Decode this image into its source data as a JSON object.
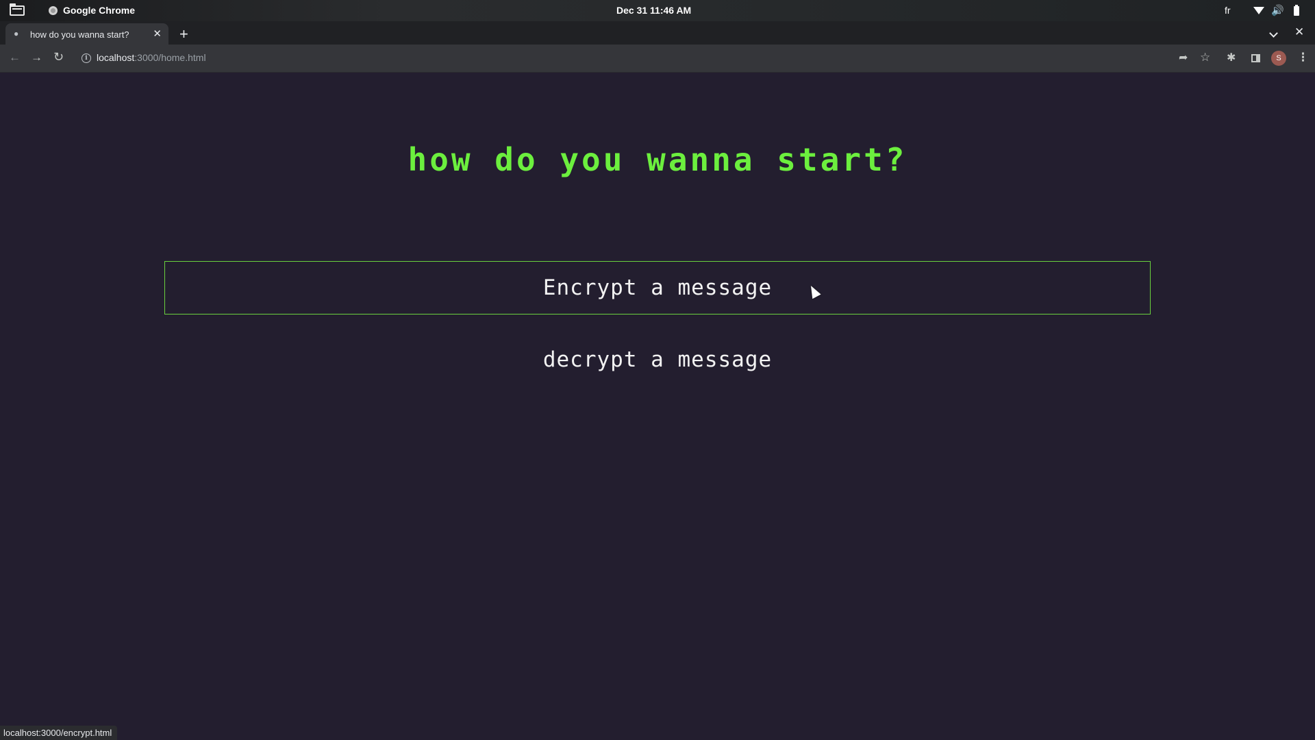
{
  "os_bar": {
    "app_name": "Google Chrome",
    "clock": "Dec 31  11:46 AM",
    "language": "fr"
  },
  "browser": {
    "tab_title": "how do you wanna start?",
    "new_tab_symbol": "+",
    "url_host": "localhost",
    "url_path": ":3000/home.html",
    "profile_initial": "S",
    "status_url": "localhost:3000/encrypt.html"
  },
  "page": {
    "heading": "how do you wanna start?",
    "encrypt_label": "Encrypt a message",
    "decrypt_label": "decrypt a message"
  },
  "colors": {
    "background": "#231e2f",
    "accent_green": "#6cef3e",
    "button_border": "#6ad23e"
  },
  "icons": [
    "files-icon",
    "chrome-icon",
    "wifi-icon",
    "volume-icon",
    "battery-icon",
    "back-arrow-icon",
    "forward-arrow-icon",
    "reload-icon",
    "info-icon",
    "share-icon",
    "star-icon",
    "extensions-icon",
    "side-panel-icon",
    "menu-icon",
    "cursor-icon"
  ]
}
